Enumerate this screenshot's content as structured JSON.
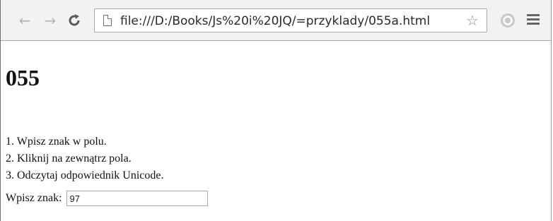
{
  "browser": {
    "url": "file:///D:/Books/Js%20i%20JQ/=przyklady/055a.html",
    "icons": {
      "back": "arrow-left-icon",
      "forward": "arrow-right-icon",
      "reload": "reload-icon",
      "page": "page-icon",
      "bookmark": "star-icon",
      "extension": "circle-extension-icon",
      "menu": "hamburger-menu-icon"
    }
  },
  "page": {
    "heading": "055",
    "steps": [
      "1. Wpisz znak w polu.",
      "2. Kliknij na zewnątrz pola.",
      "3. Odczytaj odpowiednik Unicode."
    ],
    "input": {
      "label": "Wpisz znak:",
      "value": "97"
    }
  }
}
